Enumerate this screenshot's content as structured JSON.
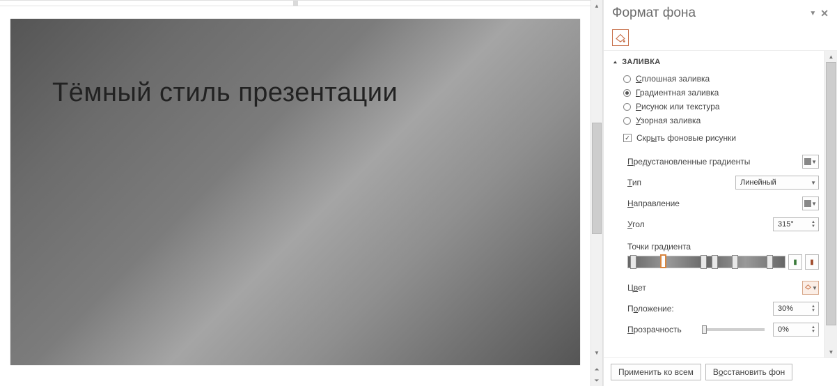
{
  "slide": {
    "title": "Тёмный стиль презентации"
  },
  "pane": {
    "title": "Формат фона",
    "section_fill": "ЗАЛИВКА",
    "fill_options": {
      "solid": "Сплошная заливка",
      "gradient": "Градиентная заливка",
      "picture": "Рисунок или текстура",
      "pattern": "Узорная заливка",
      "selected": "gradient"
    },
    "hide_bg": {
      "label": "Скрыть фоновые рисунки",
      "checked": true
    },
    "preset_gradients": "Предустановленные градиенты",
    "type": {
      "label": "Тип",
      "value": "Линейный"
    },
    "direction": "Направление",
    "angle": {
      "label": "Угол",
      "value": "315°"
    },
    "gstops_label": "Точки градиента",
    "gstops_positions": [
      3,
      22,
      48,
      55,
      68,
      90
    ],
    "gstops_selected_index": 1,
    "color_label": "Цвет",
    "position": {
      "label": "Положение:",
      "value": "30%"
    },
    "transparency": {
      "label": "Прозрачность",
      "value": "0%"
    },
    "footer": {
      "apply_all": "Применить ко всем",
      "reset": "Восстановить фон"
    }
  }
}
